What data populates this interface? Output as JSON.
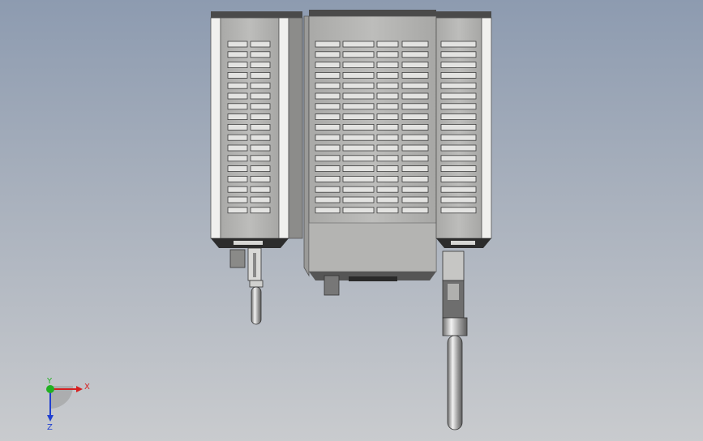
{
  "viewport": {
    "background_top": "#8d9bb0",
    "background_bottom": "#c9cbce"
  },
  "model": {
    "body_color": "#b5b5b3",
    "frame_color": "#e6e6e4",
    "dark_color": "#3a3a3a",
    "slot_count_left": 17,
    "slot_count_center": 17,
    "slot_count_right": 17
  },
  "triad": {
    "x_label": "X",
    "y_label": "Y",
    "z_label": "Z",
    "x_color": "#d62020",
    "y_color": "#22b022",
    "z_color": "#2040d0"
  }
}
